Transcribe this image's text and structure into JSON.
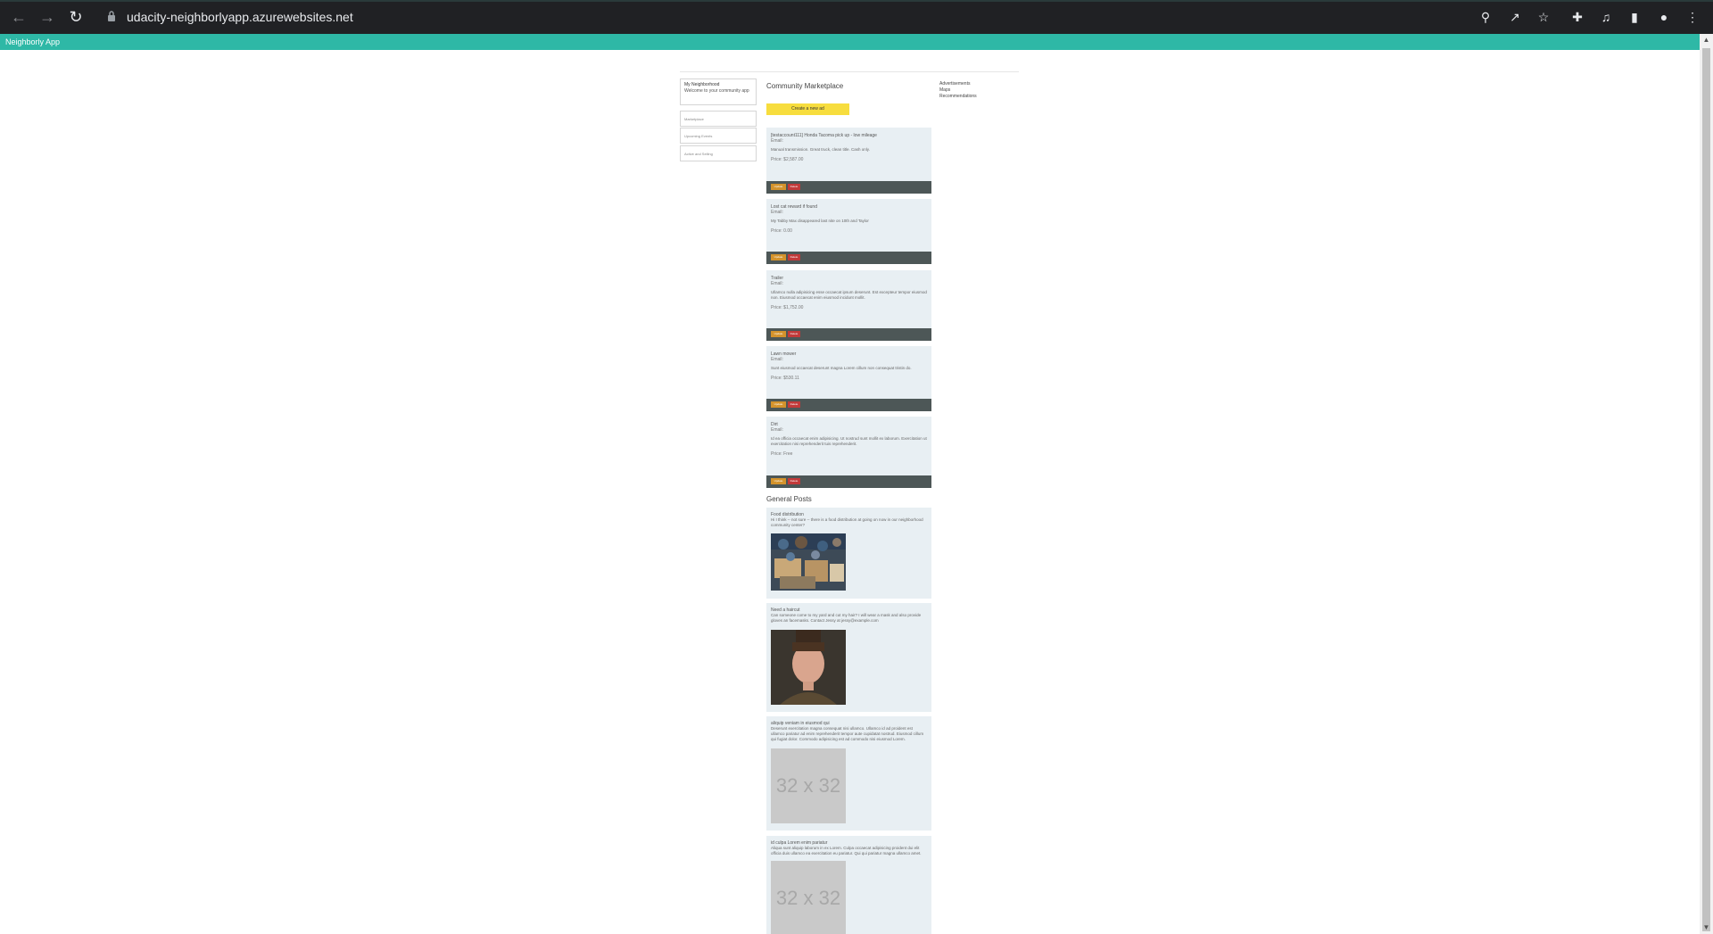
{
  "browser": {
    "url": "udacity-neighborlyapp.azurewebsites.net",
    "back_icon": "arrow-left-icon",
    "forward_icon": "arrow-right-icon",
    "reload_icon": "reload-icon"
  },
  "appbar": {
    "brand": "Neighborly App",
    "color": "#2eb8a6"
  },
  "sidebar": {
    "card_title": "My Neighborhood",
    "card_subtitle": "Welcome to your community app",
    "links": [
      "Marketplace",
      "Upcoming Events",
      "Active and Selling"
    ]
  },
  "main": {
    "marketplace_title": "Community Marketplace",
    "create_label": "Create a new ad",
    "ads": [
      {
        "title": "[testaccount111] Honda Tacoma pick up - low mileage",
        "email": "Email:",
        "description": "Manual transmission. Great truck, clean title. Cash only.",
        "price": "Price: $2,587.00"
      },
      {
        "title": "Lost cat reward if found",
        "email": "Email:",
        "description": "My Tabby Max disappeared last nite on 10th and Taylor",
        "price": "Price: 0.00"
      },
      {
        "title": "Trailer",
        "email": "Email:",
        "description": "Ullamco nulla adipisicing esse occaecat ipsum deserunt. Est excepteur tempor eiusmod non. Eiusmod occaecat enim eiusmod incidunt mollit.",
        "price": "Price: $1,752.00"
      },
      {
        "title": "Lawn mower",
        "email": "Email:",
        "description": "Sunt eiusmod occaecat deserunt magna Lorem cillum non consequat tristin do.",
        "price": "Price: $530.11"
      },
      {
        "title": "Dirt",
        "email": "Email:",
        "description": "Id ea officia occaecat enim adipisicing. Ut nostrud sunt mollit ex laborum. Exercitation ut exercitation nisi reprehenderit tuis reprehenderit.",
        "price": "Price: Free"
      }
    ],
    "update_label": "Update",
    "delete_label": "Delete",
    "posts_title": "General Posts",
    "posts": [
      {
        "title": "Food distribution",
        "description": "Hi I think -- not sure -- there is a food distribution at going on now in our neighborhood community center?",
        "image": "photo"
      },
      {
        "title": "Need a haircut",
        "description": "Can someone come to my yard and cut my hair? I will wear a mask and also provide gloves an facemasks. Contact Jessy at jessy@example.com",
        "image": "portrait"
      },
      {
        "title": "aliquip veniam in eiusmod qui",
        "description": "Deserunt exercitation magna consequat nisi ullamco. Ullamco id ad proident est ullamco pariatur ad enim reprehenderit tempor aute cupidatat nostrud. Eiusmod cillum qui fugiat dolor. Commodo adipisicing est ad commodo nisi eiusmod Lorem.",
        "image": "placeholder",
        "placeholder_text": "32 x 32"
      },
      {
        "title": "id culpa Lorem enim pariatur",
        "description": "Aliqua sunt aliquip laborum in ex Lorem. Culpa occaecat adipisicing proident dui elit officia duis ullamco ea exercitation eu pariatur. Qui qui pariatur magna ullamco amet.",
        "image": "placeholder",
        "placeholder_text": "32 x 32"
      }
    ]
  },
  "right_links": [
    "Advertisements",
    "Maps",
    "Recommendations"
  ]
}
